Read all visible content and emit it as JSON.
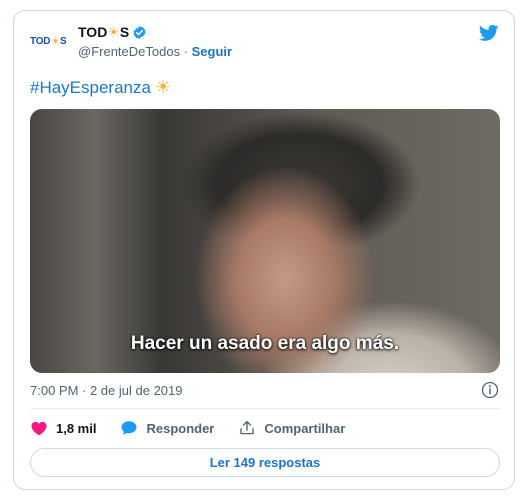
{
  "author": {
    "avatar_text_a": "TOD",
    "avatar_text_b": "S",
    "name_a": "TOD",
    "name_b": "S",
    "handle": "@FrenteDeTodos",
    "separator": " · ",
    "follow_label": "Seguir"
  },
  "tweet": {
    "text": "#HayEsperanza",
    "subtitle": "Hacer un asado era algo más.",
    "timestamp": "7:00 PM · 2 de jul de 2019"
  },
  "actions": {
    "likes": "1,8 mil",
    "reply_label": "Responder",
    "share_label": "Compartilhar"
  },
  "replies_button": "Ler 149 respostas",
  "colors": {
    "accent": "#1d9bf0",
    "link": "#1d74c7",
    "like": "#f91880",
    "sun": "#f2b134"
  },
  "icons": [
    "sun-icon",
    "verified-badge-icon",
    "twitter-bird-icon",
    "heart-icon",
    "speech-bubble-icon",
    "share-icon",
    "info-icon"
  ]
}
